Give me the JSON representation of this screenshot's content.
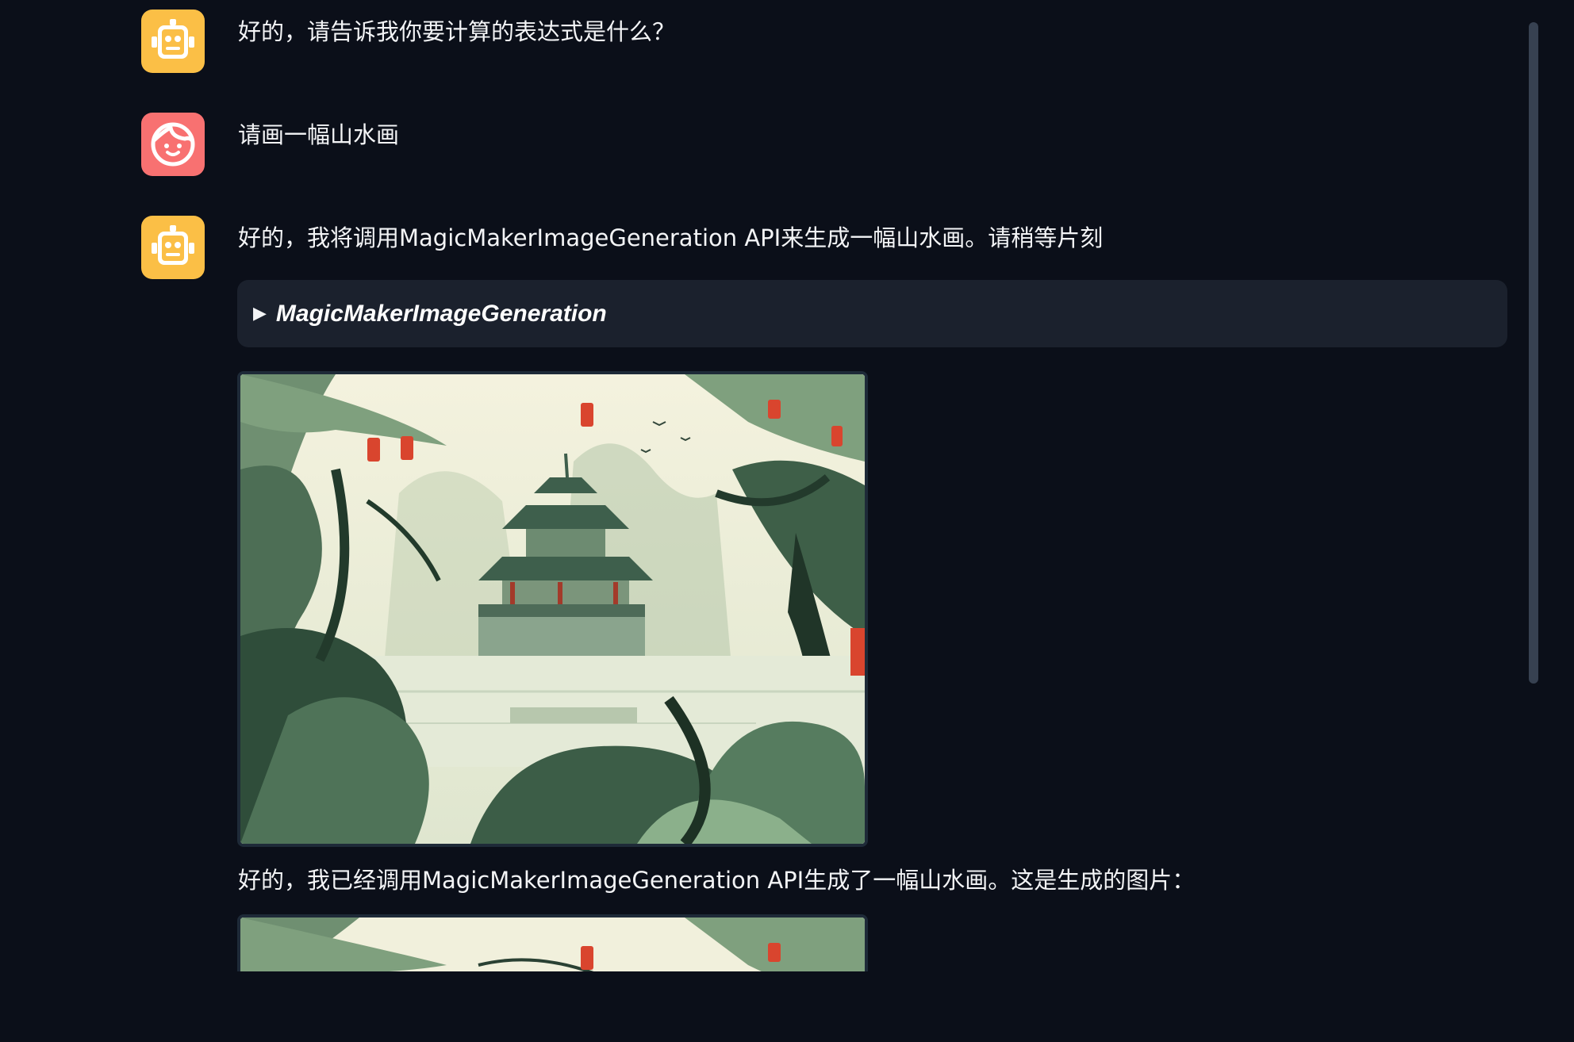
{
  "messages": [
    {
      "role": "bot",
      "text": "好的，请告诉我你要计算的表达式是什么？"
    },
    {
      "role": "user",
      "text": "请画一幅山水画"
    },
    {
      "role": "bot",
      "text": "好的，我将调用MagicMakerImageGeneration API来生成一幅山水画。请稍等片刻"
    },
    {
      "role": "bot",
      "text": "好的，我已经调用MagicMakerImageGeneration API生成了一幅山水画。这是生成的图片："
    }
  ],
  "tool_call": {
    "toggle_icon": "triangle-right-icon",
    "name": "MagicMakerImageGeneration"
  },
  "icons": {
    "bot_avatar": "robot-icon",
    "user_avatar": "face-icon"
  },
  "colors": {
    "background": "#0b0f19",
    "bot_avatar": "#fbbf46",
    "user_avatar": "#f87171",
    "tool_panel": "#1b212d",
    "image_border": "#1e2a38",
    "scrollbar": "#374151"
  }
}
